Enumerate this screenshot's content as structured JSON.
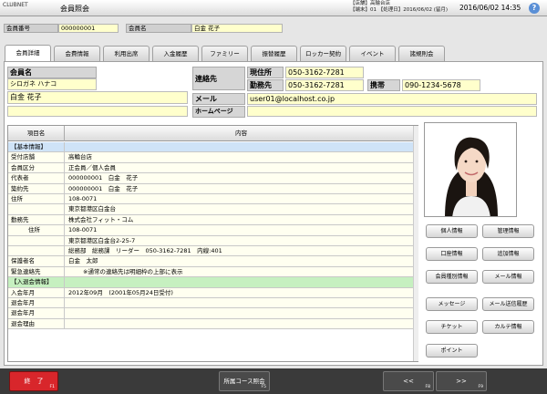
{
  "app": {
    "brand": "CLUBNET",
    "screen_title": "会員照会",
    "store_line1": "【店舗】高輪台店",
    "store_line2": "【端末】01 【処理日】2016/06/02 (留月)",
    "clock": "2016/06/02 14:35",
    "help": "?"
  },
  "idbar": {
    "member_no_label": "会員番号",
    "member_no": "000000001",
    "member_name_label": "会員名",
    "member_name": "白金 花子"
  },
  "tabs": [
    {
      "label": "会員詳細",
      "active": true
    },
    {
      "label": "会費情報"
    },
    {
      "label": "利用出席"
    },
    {
      "label": "入金履歴"
    },
    {
      "label": "ファミリー"
    },
    {
      "label": "振替履歴"
    },
    {
      "label": "ロッカー契約"
    },
    {
      "label": "イベント"
    },
    {
      "label": "諸規則会"
    }
  ],
  "header": {
    "name_label": "会員名",
    "kana": "シロガネ ハナコ",
    "name": "白金 花子",
    "contact_label": "連絡先",
    "home_label": "現住所",
    "home_phone": "050-3162-7281",
    "work_label": "勤務先",
    "work_phone": "050-3162-7281",
    "mobile_label": "携帯",
    "mobile_phone": "090-1234-5678",
    "mail_label": "メール",
    "mail": "user01@localhost.co.jp",
    "homepage_label": "ホームページ",
    "homepage": ""
  },
  "table": {
    "col_item": "項目名",
    "col_content": "内容",
    "rows": [
      {
        "k": "【基本情報】",
        "v": "",
        "style": "sec-blue"
      },
      {
        "k": "受付店舗",
        "v": "高輪台店"
      },
      {
        "k": "会員区分",
        "v": "正会員／個人会員"
      },
      {
        "k": "代表者",
        "v": "000000001　白金　花子"
      },
      {
        "k": "築約先",
        "v": "000000001　白金　花子"
      },
      {
        "k": "住所",
        "v": "108-0071"
      },
      {
        "k": "",
        "v": "東京都港区白金台"
      },
      {
        "k": "勤務先",
        "v": "株式会社フィット・コム"
      },
      {
        "k": "住所",
        "v": "108-0071",
        "indent": true
      },
      {
        "k": "",
        "v": "東京都港区白金台2-25-7"
      },
      {
        "k": "",
        "v": "総務部　総務課　リーダー　050-3162-7281　内線:401"
      },
      {
        "k": "保護者名",
        "v": "白金　太郎"
      },
      {
        "k": "緊急連絡先",
        "v": "※通常の連絡先は明細枠の上部に表示",
        "note": true
      },
      {
        "k": "【入退会情報】",
        "v": "",
        "style": "sec-green"
      },
      {
        "k": "入会年月",
        "v": "2012年09月　(2001年05月24日受付)"
      },
      {
        "k": "退会年月",
        "v": ""
      },
      {
        "k": "退会年月",
        "v": ""
      },
      {
        "k": "退会理由",
        "v": ""
      }
    ]
  },
  "side_buttons": [
    [
      "個人情報",
      "管理情報"
    ],
    [
      "口座情報",
      "追加情報"
    ],
    [
      "会員種別情報",
      "メール情報"
    ],
    [
      "メッセージ",
      "メール送信履歴"
    ],
    [
      "チケット",
      "カルテ情報"
    ],
    [
      "ポイント"
    ]
  ],
  "footer": {
    "end_label": "終　了",
    "end_key": "F1",
    "course_label": "所属コース照会",
    "course_key": "F5",
    "prev_label": "<<",
    "prev_key": "F8",
    "next_label": ">>",
    "next_key": "F9"
  },
  "colors": {
    "value_bg": "#ffffcc",
    "section_blue": "#cfe3f7",
    "section_green": "#c6f0c0",
    "end_button": "#d8262b"
  }
}
